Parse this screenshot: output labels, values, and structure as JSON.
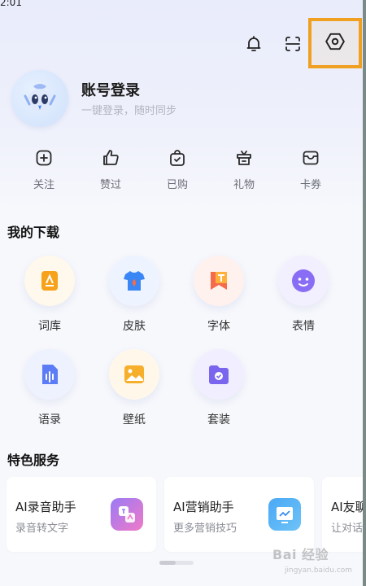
{
  "status_bar": {
    "time": "2:01"
  },
  "header": {
    "icons": [
      "bell-icon",
      "scan-icon",
      "settings-icon"
    ]
  },
  "account": {
    "title": "账号登录",
    "subtitle": "一键登录，随时同步"
  },
  "quick_actions": [
    {
      "label": "关注",
      "icon": "plus-square-icon"
    },
    {
      "label": "赞过",
      "icon": "thumbs-up-icon"
    },
    {
      "label": "已购",
      "icon": "shopping-bag-icon"
    },
    {
      "label": "礼物",
      "icon": "gift-icon"
    },
    {
      "label": "卡券",
      "icon": "coupon-icon"
    }
  ],
  "downloads": {
    "title": "我的下载",
    "items": [
      {
        "label": "词库",
        "icon": "lexicon-icon"
      },
      {
        "label": "皮肤",
        "icon": "skin-icon"
      },
      {
        "label": "字体",
        "icon": "font-icon"
      },
      {
        "label": "表情",
        "icon": "emoji-icon"
      },
      {
        "label": "语录",
        "icon": "quotes-icon"
      },
      {
        "label": "壁纸",
        "icon": "wallpaper-icon"
      },
      {
        "label": "套装",
        "icon": "bundle-icon"
      }
    ]
  },
  "services": {
    "title": "特色服务",
    "cards": [
      {
        "title": "AI录音助手",
        "subtitle": "录音转文字",
        "icon": "translate-icon"
      },
      {
        "title": "AI营销助手",
        "subtitle": "更多营销技巧",
        "icon": "marketing-icon"
      },
      {
        "title": "AI友聊",
        "subtitle": "让对话",
        "icon": "chat-icon"
      }
    ]
  },
  "watermark": {
    "text": "Bai 经验",
    "sub": "jingyan.baidu.com"
  },
  "colors": {
    "highlight": "#f0a020",
    "accent": "#5b6cf0",
    "text_muted": "#b3b6c0"
  }
}
